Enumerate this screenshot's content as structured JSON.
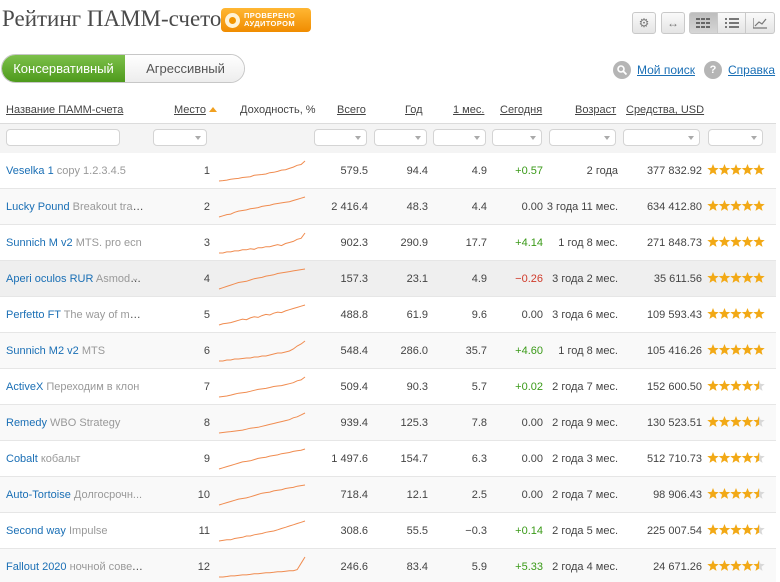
{
  "header": {
    "title": "Рейтинг ПАММ-счетов",
    "badge": "ПРОВЕРЕНО\nАУДИТОРОМ"
  },
  "toolbar": {
    "settings_icon": "gear-icon",
    "expand_icon": "horizontal-arrows-icon",
    "view_icons": [
      "grid-view-icon",
      "list-view-icon",
      "chart-view-icon"
    ],
    "active_view": "grid-view-icon"
  },
  "tabs": [
    {
      "label": "Консервативный",
      "active": true
    },
    {
      "label": "Агрессивный",
      "active": false
    }
  ],
  "links": {
    "my_search": "Мой поиск",
    "help": "Справка",
    "help_icon_glyph": "?"
  },
  "columns": [
    "Название ПАММ-счета",
    "Место",
    "Доходность, %",
    "Всего",
    "Год",
    "1 мес.",
    "Сегодня",
    "Возраст",
    "Средства, USD"
  ],
  "colors": {
    "accent_green": "#5ba82a",
    "badge_orange": "#f39c12",
    "link_blue": "#1a6fb5",
    "positive": "#3a9a18",
    "negative": "#d03a2a",
    "sparkline": "#f08c50",
    "star": "#f2a916"
  },
  "rows": [
    {
      "name": "Veselka 1",
      "strategy": "copy 1.2.3.4.5",
      "place": "1",
      "total": "579.5",
      "year": "94.4",
      "month": "4.9",
      "today": "+0.57",
      "age": "2 года",
      "funds": "377 832.92",
      "rating": 5,
      "spark": [
        1,
        1.5,
        2,
        3,
        3.5,
        4,
        5,
        5.5,
        6,
        7.5,
        8,
        8.5,
        9,
        10.5,
        11,
        12,
        13.5,
        14,
        15.5,
        17,
        19,
        20,
        24
      ]
    },
    {
      "name": "Lucky Pound",
      "strategy": "Breakout trad...",
      "place": "2",
      "total": "2 416.4",
      "year": "48.3",
      "month": "4.4",
      "today": "0.00",
      "age": "3 года 11 мес.",
      "funds": "634 412.80",
      "rating": 5,
      "spark": [
        1,
        2,
        3,
        3.5,
        5,
        6,
        6.5,
        7,
        8,
        8.5,
        9,
        10,
        10.5,
        11,
        12,
        12.5,
        13,
        13.5,
        14,
        15,
        16,
        17,
        18
      ]
    },
    {
      "name": "Sunnich M v2",
      "strategy": "MTS. pro ecn",
      "place": "3",
      "total": "902.3",
      "year": "290.9",
      "month": "17.7",
      "today": "+4.14",
      "age": "1 год 8 мес.",
      "funds": "271 848.73",
      "rating": 5,
      "spark": [
        1,
        1,
        2,
        2,
        3,
        3,
        4,
        4,
        5,
        4.5,
        6,
        6,
        7,
        7,
        8,
        9,
        8,
        10,
        11,
        12,
        14,
        15,
        20
      ]
    },
    {
      "name": "Aperi oculos RUR",
      "strategy": "Asmode...",
      "place": "4",
      "total": "157.3",
      "year": "23.1",
      "month": "4.9",
      "today": "−0.26",
      "age": "3 года 2 мес.",
      "funds": "35 611.56",
      "rating": 5,
      "spark": [
        1,
        2,
        3,
        4,
        5,
        6,
        6.5,
        7,
        8,
        9,
        9.5,
        10,
        11,
        11.5,
        12,
        13,
        13.5,
        14,
        14.5,
        15,
        15.5,
        16,
        16.5
      ]
    },
    {
      "name": "Perfetto FT",
      "strategy": "The way of mo...",
      "place": "5",
      "total": "488.8",
      "year": "61.9",
      "month": "9.6",
      "today": "0.00",
      "age": "3 года 6 мес.",
      "funds": "109 593.43",
      "rating": 5,
      "spark": [
        1,
        2,
        2.5,
        3,
        4,
        5,
        6,
        5.5,
        7,
        8,
        7.5,
        9,
        10,
        9.5,
        11,
        12,
        11.5,
        13,
        14,
        15,
        16,
        17,
        18
      ]
    },
    {
      "name": "Sunnich M2 v2",
      "strategy": "MTS",
      "place": "6",
      "total": "548.4",
      "year": "286.0",
      "month": "35.7",
      "today": "+4.60",
      "age": "1 год 8 мес.",
      "funds": "105 416.26",
      "rating": 5,
      "spark": [
        1,
        1,
        2,
        2,
        3,
        3,
        3.5,
        4,
        4,
        5,
        5,
        6,
        6,
        7,
        8,
        9,
        9,
        10,
        11,
        13,
        16,
        18,
        21
      ]
    },
    {
      "name": "ActiveX",
      "strategy": "Переходим в клон",
      "place": "7",
      "total": "509.4",
      "year": "90.3",
      "month": "5.7",
      "today": "+0.02",
      "age": "2 года 7 мес.",
      "funds": "152 600.50",
      "rating": 4.5,
      "spark": [
        1,
        1.5,
        2,
        3,
        4,
        5,
        5.5,
        6,
        7,
        8,
        9,
        9.5,
        10,
        11,
        12,
        12.5,
        13,
        14,
        15,
        16,
        18,
        19,
        22
      ]
    },
    {
      "name": "Remedy",
      "strategy": "WBO Strategy",
      "place": "8",
      "total": "939.4",
      "year": "125.3",
      "month": "7.8",
      "today": "0.00",
      "age": "2 года 9 мес.",
      "funds": "130 523.51",
      "rating": 4.5,
      "spark": [
        1,
        1.5,
        2,
        2.5,
        3,
        3.5,
        4,
        5,
        6,
        6.5,
        7,
        8,
        9,
        10,
        11,
        12,
        13,
        14,
        15,
        17,
        18,
        20,
        22
      ]
    },
    {
      "name": "Cobalt",
      "strategy": "кобальт",
      "place": "9",
      "total": "1 497.6",
      "year": "154.7",
      "month": "6.3",
      "today": "0.00",
      "age": "2 года 3 мес.",
      "funds": "512 710.73",
      "rating": 4.5,
      "spark": [
        1,
        2,
        3,
        4,
        5,
        6,
        7,
        7.5,
        8,
        9,
        10,
        10.5,
        11,
        12,
        12.5,
        13,
        14,
        14.5,
        15,
        16,
        16.5,
        17,
        18
      ]
    },
    {
      "name": "Auto-Tortoise",
      "strategy": "Долгосрочн...",
      "place": "10",
      "total": "718.4",
      "year": "12.1",
      "month": "2.5",
      "today": "0.00",
      "age": "2 года 7 мес.",
      "funds": "98 906.43",
      "rating": 4.5,
      "spark": [
        1,
        2,
        3,
        4,
        5,
        6,
        6.5,
        7,
        8,
        9,
        10,
        11,
        11.5,
        12,
        13,
        13.5,
        14,
        15,
        15.5,
        16,
        17,
        17.5,
        18
      ]
    },
    {
      "name": "Second way",
      "strategy": "Impulse",
      "place": "11",
      "total": "308.6",
      "year": "55.5",
      "month": "−0.3",
      "today": "+0.14",
      "age": "2 года 5 мес.",
      "funds": "225 007.54",
      "rating": 4.5,
      "spark": [
        1,
        1.5,
        2,
        2,
        3,
        3.5,
        4,
        5,
        5,
        6,
        6.5,
        7,
        8,
        8.5,
        9,
        10,
        11,
        12,
        13,
        14,
        15,
        16,
        17
      ]
    },
    {
      "name": "Fallout 2020",
      "strategy": "ночной совет...",
      "place": "12",
      "total": "246.6",
      "year": "83.4",
      "month": "5.9",
      "today": "+5.33",
      "age": "2 года 4 мес.",
      "funds": "24 671.26",
      "rating": 4.5,
      "spark": [
        1,
        1,
        1.5,
        2,
        2,
        2.5,
        3,
        3,
        3.5,
        4,
        4,
        4.5,
        5,
        5,
        5.5,
        6,
        6,
        6.5,
        7,
        7,
        8,
        14,
        20
      ]
    }
  ]
}
